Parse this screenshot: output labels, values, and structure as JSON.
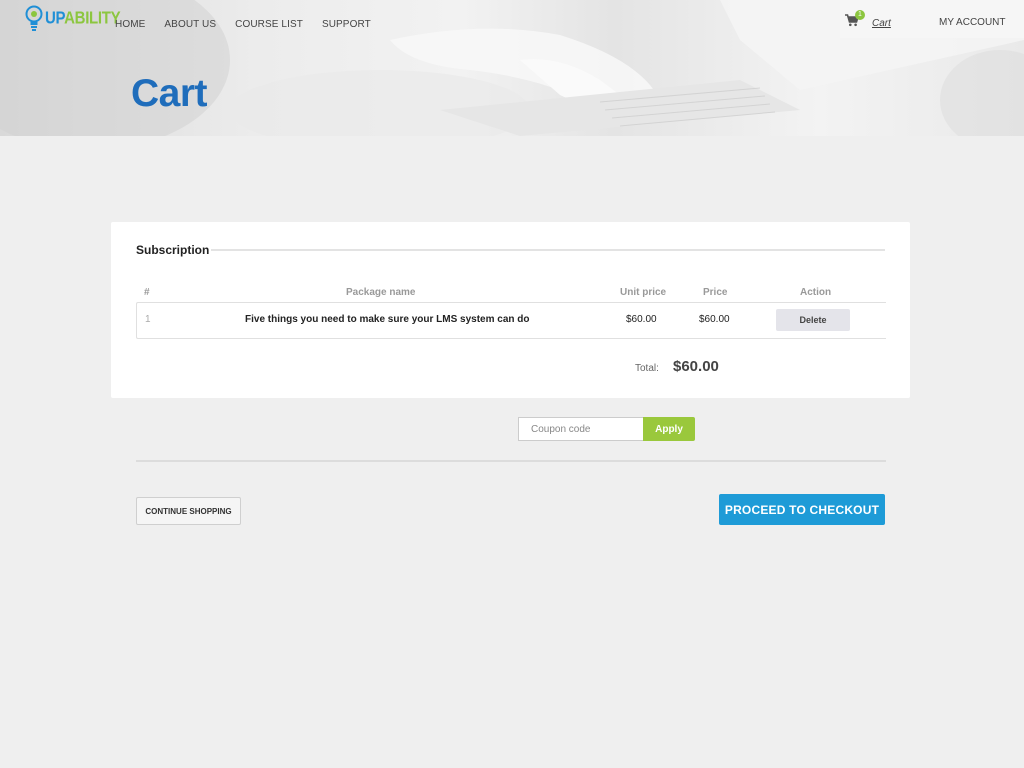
{
  "brand": {
    "logo_up": "UP",
    "logo_ability": "ABILITY",
    "primary_color": "#1f6dbb",
    "accent_green": "#8cc63f",
    "accent_blue": "#1e9bd7"
  },
  "nav": {
    "items": [
      {
        "label": "HOME"
      },
      {
        "label": "ABOUT US"
      },
      {
        "label": "COURSE LIST"
      },
      {
        "label": "SUPPORT"
      }
    ],
    "cart_label": "Cart",
    "cart_count": "1",
    "account_label": "MY ACCOUNT"
  },
  "page": {
    "title": "Cart"
  },
  "cart": {
    "section_title": "Subscription",
    "columns": [
      "#",
      "Package name",
      "Unit price",
      "Price",
      "Action"
    ],
    "rows": [
      {
        "num": "1",
        "name": "Five things you need to make sure your LMS system can do",
        "unit_price": "$60.00",
        "price": "$60.00",
        "action_label": "Delete"
      }
    ],
    "total_label": "Total:",
    "total_value": "$60.00"
  },
  "coupon": {
    "placeholder": "Coupon code",
    "apply_label": "Apply"
  },
  "actions": {
    "continue_label": "CONTINUE SHOPPING",
    "checkout_label": "PROCEED TO CHECKOUT"
  }
}
